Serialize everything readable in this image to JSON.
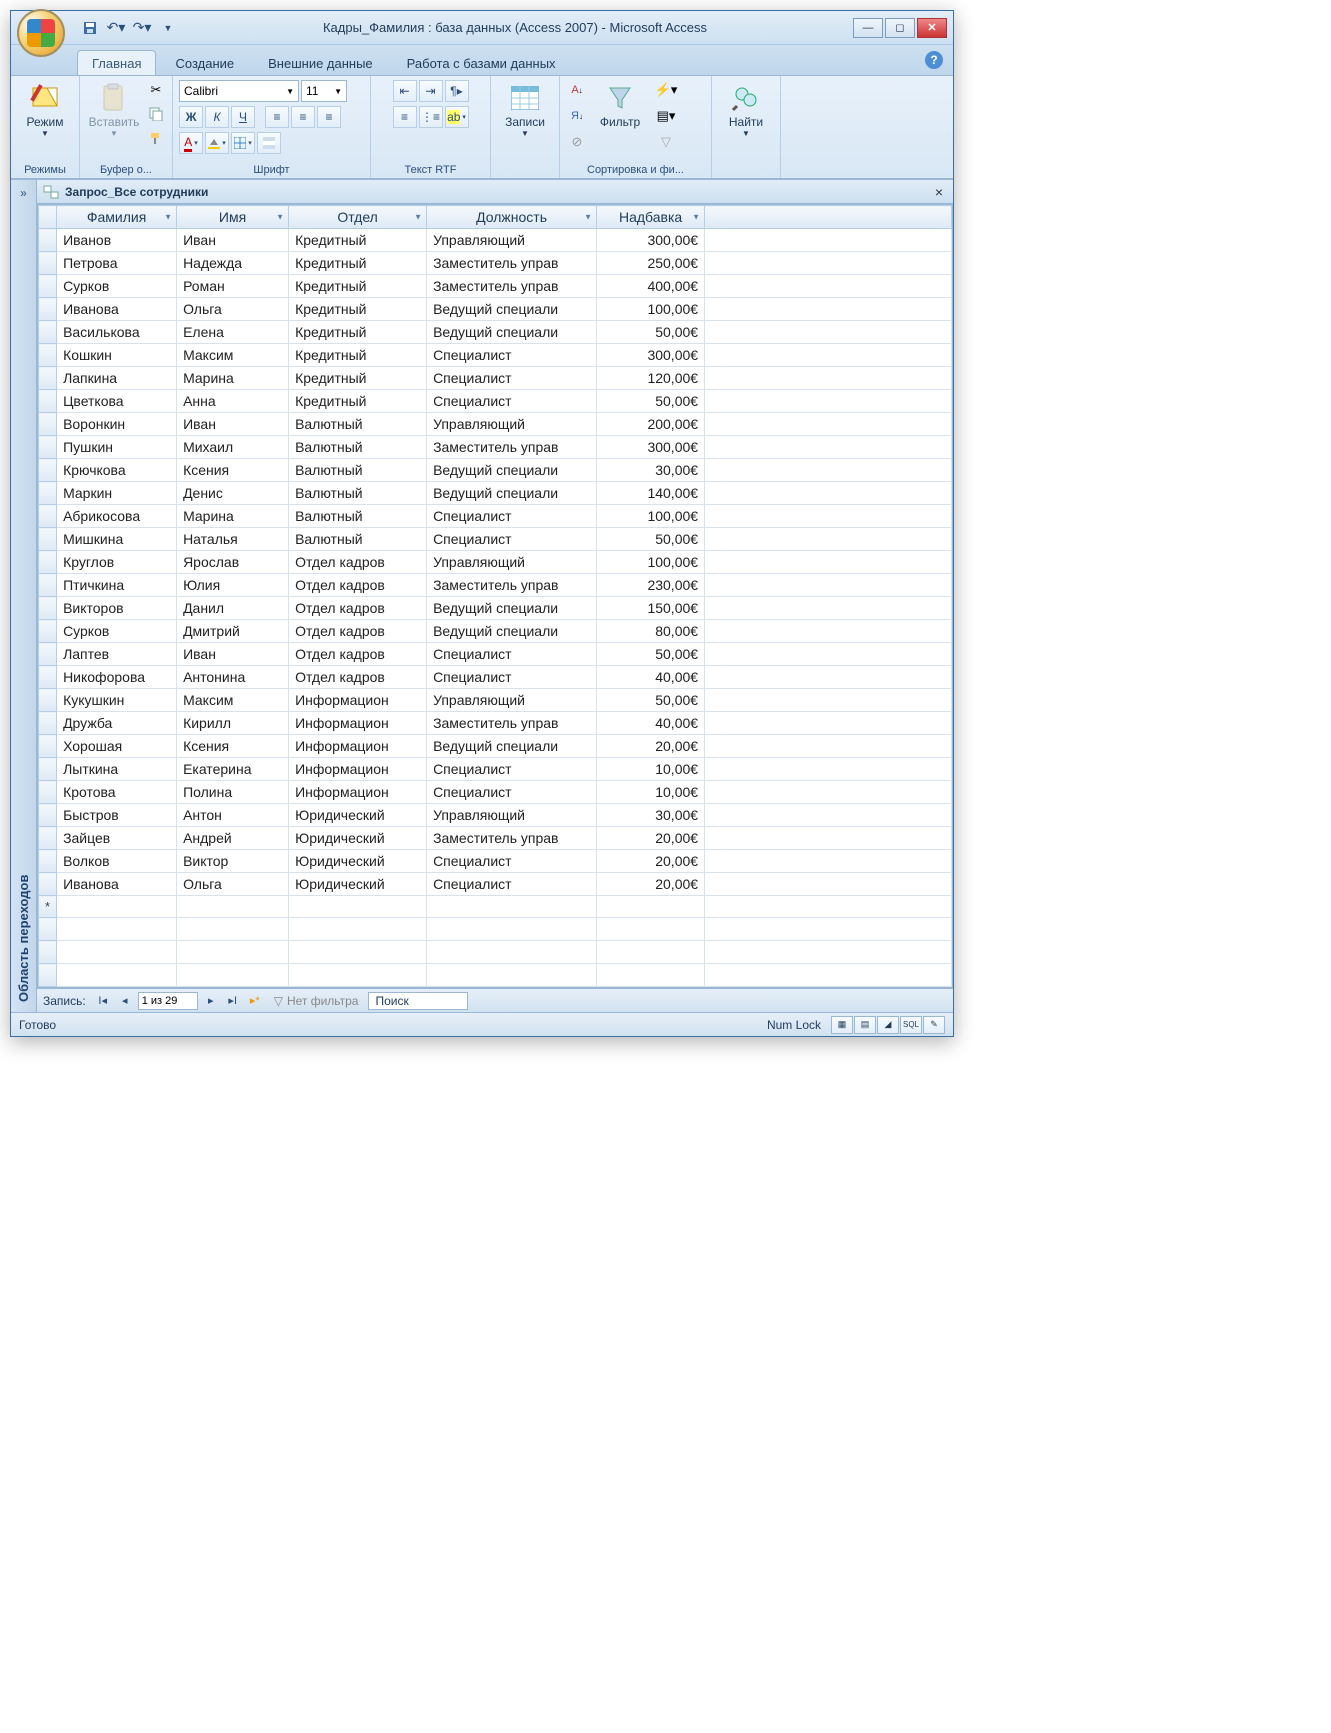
{
  "title": "Кадры_Фамилия : база данных (Access 2007)  -  Microsoft Access",
  "tabs": {
    "home": "Главная",
    "create": "Создание",
    "external": "Внешние данные",
    "dbtools": "Работа с базами данных"
  },
  "ribbon": {
    "modes": {
      "btn": "Режим",
      "group": "Режимы"
    },
    "clipboard": {
      "paste": "Вставить",
      "group": "Буфер о..."
    },
    "font": {
      "name": "Calibri",
      "size": "11",
      "group": "Шрифт"
    },
    "rtf": {
      "group": "Текст RTF"
    },
    "records": {
      "btn": "Записи"
    },
    "sortfilter": {
      "filter": "Фильтр",
      "group": "Сортировка и фи..."
    },
    "find": {
      "btn": "Найти"
    }
  },
  "navpane": {
    "toggle": "»",
    "label": "Область переходов"
  },
  "doc": {
    "title": "Запрос_Все сотрудники"
  },
  "columns": [
    "Фамилия",
    "Имя",
    "Отдел",
    "Должность",
    "Надбавка"
  ],
  "rows": [
    [
      "Иванов",
      "Иван",
      "Кредитный",
      "Управляющий",
      "300,00€"
    ],
    [
      "Петрова",
      "Надежда",
      "Кредитный",
      "Заместитель управ",
      "250,00€"
    ],
    [
      "Сурков",
      "Роман",
      "Кредитный",
      "Заместитель управ",
      "400,00€"
    ],
    [
      "Иванова",
      "Ольга",
      "Кредитный",
      "Ведущий специали",
      "100,00€"
    ],
    [
      "Василькова",
      "Елена",
      "Кредитный",
      "Ведущий специали",
      "50,00€"
    ],
    [
      "Кошкин",
      "Максим",
      "Кредитный",
      "Специалист",
      "300,00€"
    ],
    [
      "Лапкина",
      "Марина",
      "Кредитный",
      "Специалист",
      "120,00€"
    ],
    [
      "Цветкова",
      "Анна",
      "Кредитный",
      "Специалист",
      "50,00€"
    ],
    [
      "Воронкин",
      "Иван",
      "Валютный",
      "Управляющий",
      "200,00€"
    ],
    [
      "Пушкин",
      "Михаил",
      "Валютный",
      "Заместитель управ",
      "300,00€"
    ],
    [
      "Крючкова",
      "Ксения",
      "Валютный",
      "Ведущий специали",
      "30,00€"
    ],
    [
      "Маркин",
      "Денис",
      "Валютный",
      "Ведущий специали",
      "140,00€"
    ],
    [
      "Абрикосова",
      "Марина",
      "Валютный",
      "Специалист",
      "100,00€"
    ],
    [
      "Мишкина",
      "Наталья",
      "Валютный",
      "Специалист",
      "50,00€"
    ],
    [
      "Круглов",
      "Ярослав",
      "Отдел кадров",
      "Управляющий",
      "100,00€"
    ],
    [
      "Птичкина",
      "Юлия",
      "Отдел кадров",
      "Заместитель управ",
      "230,00€"
    ],
    [
      "Викторов",
      "Данил",
      "Отдел кадров",
      "Ведущий специали",
      "150,00€"
    ],
    [
      "Сурков",
      "Дмитрий",
      "Отдел кадров",
      "Ведущий специали",
      "80,00€"
    ],
    [
      "Лаптев",
      "Иван",
      "Отдел кадров",
      "Специалист",
      "50,00€"
    ],
    [
      "Никофорова",
      "Антонина",
      "Отдел кадров",
      "Специалист",
      "40,00€"
    ],
    [
      "Кукушкин",
      "Максим",
      "Информацион",
      "Управляющий",
      "50,00€"
    ],
    [
      "Дружба",
      "Кирилл",
      "Информацион",
      "Заместитель управ",
      "40,00€"
    ],
    [
      "Хорошая",
      "Ксения",
      "Информацион",
      "Ведущий специали",
      "20,00€"
    ],
    [
      "Лыткина",
      "Екатерина",
      "Информацион",
      "Специалист",
      "10,00€"
    ],
    [
      "Кротова",
      "Полина",
      "Информацион",
      "Специалист",
      "10,00€"
    ],
    [
      "Быстров",
      "Антон",
      "Юридический",
      "Управляющий",
      "30,00€"
    ],
    [
      "Зайцев",
      "Андрей",
      "Юридический",
      "Заместитель управ",
      "20,00€"
    ],
    [
      "Волков",
      "Виктор",
      "Юридический",
      "Специалист",
      "20,00€"
    ],
    [
      "Иванова",
      "Ольга",
      "Юридический",
      "Специалист",
      "20,00€"
    ]
  ],
  "recnav": {
    "label": "Запись:",
    "pos": "1 из 29",
    "nofilter": "Нет фильтра",
    "search": "Поиск"
  },
  "status": {
    "ready": "Готово",
    "numlock": "Num Lock"
  }
}
